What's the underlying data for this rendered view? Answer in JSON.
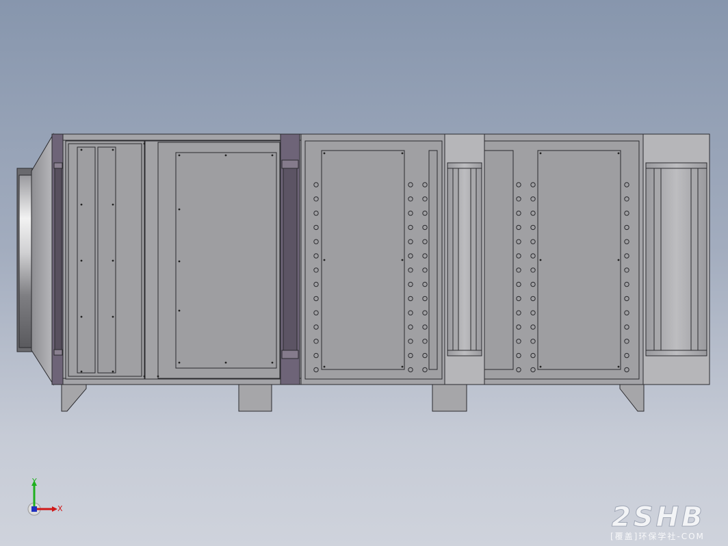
{
  "watermark": {
    "logo_text": "2SHB",
    "site_text": "[覆盖]环保学社-COM"
  },
  "triad": {
    "y_label": "Y",
    "x_label": "X",
    "y_color": "#1fb01f",
    "x_color": "#d01818",
    "z_color": "#2030c0"
  },
  "colors": {
    "steel": "#a0a0a4",
    "steel_light": "#b4b4b8",
    "panel": "#9c9c9e",
    "frame_purple": "#6e6478",
    "outline": "#2a2a2e"
  }
}
